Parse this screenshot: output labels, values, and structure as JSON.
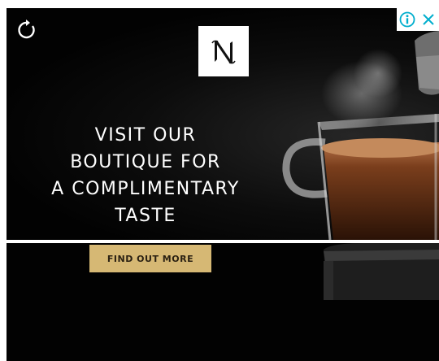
{
  "ad": {
    "headline_lines": [
      "VISIT OUR",
      "BOUTIQUE FOR",
      "A COMPLIMENTARY",
      "TASTE"
    ],
    "cta_label": "FIND OUT MORE",
    "logo_letter": "N",
    "icons": {
      "replay": "replay-icon",
      "info": "info-icon",
      "close": "close-icon",
      "logo": "nespresso-logo-icon"
    },
    "colors": {
      "background": "#020202",
      "cta_background": "#d6b874",
      "cta_text": "#2a2012",
      "adchoices_blue": "#00aecd",
      "text": "#ffffff"
    }
  }
}
